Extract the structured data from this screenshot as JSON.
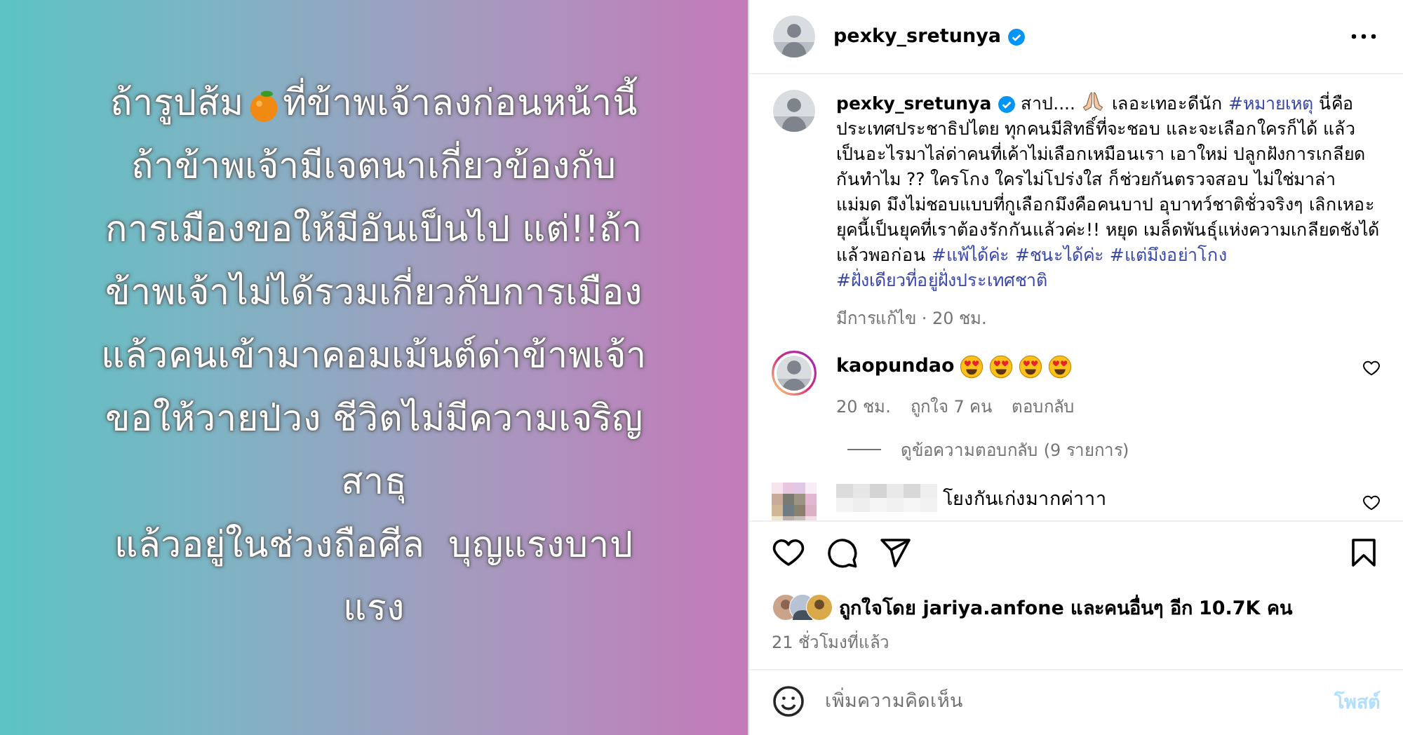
{
  "image": {
    "first_line": [
      "ถ้ารูปส้ม",
      "ที่ข้าพเจ้าลงก่อนหน้านี้"
    ],
    "lines": [
      "ถ้าข้าพเจ้ามีเจตนาเกี่ยวข้องกับ",
      "การเมืองขอให้มีอันเป็นไป แต่!!ถ้า",
      "ข้าพเจ้าไม่ได้รวมเกี่ยวกับการเมือง",
      "แล้วคนเข้ามาคอมเม้นต์ด่าข้าพเจ้า",
      "ขอให้วายป่วง ชีวิตไม่มีความเจริญ",
      "สาธุ",
      "แล้วอยู่ในช่วงถือศีล  บุญแรงบาป",
      "แรง"
    ]
  },
  "header": {
    "username": "pexky_sretunya",
    "verified": true
  },
  "caption": {
    "username": "pexky_sretunya",
    "verified": true,
    "segments": [
      {
        "kind": "text",
        "text": "สาป...."
      },
      {
        "kind": "emoji"
      },
      {
        "kind": "text",
        "text": "เลอะเทอะดีนัก"
      },
      {
        "kind": "tag",
        "text": "#หมายเหตุ"
      },
      {
        "kind": "text",
        "text": "นี่คือประเทศประชาธิปไตย ทุกคนมีสิทธิ์ที่จะชอบ และจะเลือกใครก็ได้ แล้วเป็นอะไรมาไล่ด่าคนที่เค้าไม่เลือกเหมือนเรา เอาใหม่ ปลูกฝังการเกลียดกันทำไม ?? ใครโกง ใครไม่โปร่งใส ก็ช่วยกันตรวจสอบ ไม่ใช่มาล่าแม่มด มึงไม่ชอบแบบที่กูเลือกมึงคือคนบาป อุบาทว์ชาติชั่วจริงๆ เลิกเหอะ ยุคนี้เป็นยุคที่เราต้องรักกันแล้วค่ะ!! หยุด เมล็ดพันธุ์แห่งความเกลียดชังได้แล้วพอก่อน"
      },
      {
        "kind": "tag",
        "text": "#แพ้ได้ค่ะ"
      },
      {
        "kind": "tag",
        "text": "#ชนะได้ค่ะ"
      },
      {
        "kind": "tag",
        "text": "#แต่มึงอย่าโกง"
      },
      {
        "kind": "tag",
        "text": "#ฝั่งเดียวที่อยู่ฝั่งประเทศชาติ"
      }
    ],
    "time": "มีการแก้ไข · 20 ชม."
  },
  "comments": [
    {
      "username": "kaopundao",
      "author_hidden": false,
      "story_ring": true,
      "segments": [
        {
          "kind": "emoji"
        },
        {
          "kind": "emoji"
        },
        {
          "kind": "emoji"
        },
        {
          "kind": "emoji"
        }
      ],
      "time": "20 ชม.",
      "likes": "ถูกใจ 7 คน",
      "reply": "ตอบกลับ",
      "liked": false,
      "view_replies": "ดูข้อความตอบกลับ (9 รายการ)"
    },
    {
      "author_hidden": true,
      "segments": [
        {
          "kind": "text",
          "text": "โยงกันเก่งมากค่าาา"
        }
      ],
      "liked": false
    }
  ],
  "actions": {
    "liked": false,
    "saved": false
  },
  "likes": "ถูกใจโดย jariya.anfone และคนอื่นๆ อีก 10.7K คน",
  "posted": "21 ชั่วโมงที่แล้ว",
  "comment_box": {
    "placeholder": "เพิ่มความคิดเห็น",
    "post_button": "โพสต์",
    "disabled": true
  }
}
